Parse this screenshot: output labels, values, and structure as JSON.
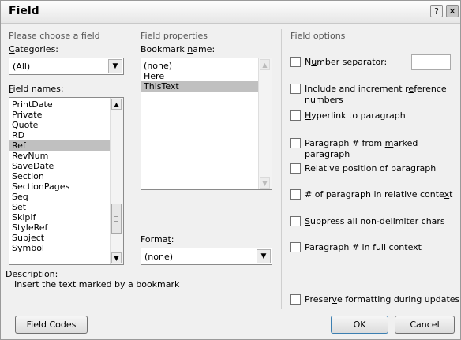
{
  "window": {
    "title": "Field",
    "help_button": "?",
    "close_button": "✕"
  },
  "left": {
    "header": "Please choose a field",
    "categories_label": "Categories:",
    "categories_value": "(All)",
    "field_names_label": "Field names:",
    "field_names": [
      "PrintDate",
      "Private",
      "Quote",
      "RD",
      "Ref",
      "RevNum",
      "SaveDate",
      "Section",
      "SectionPages",
      "Seq",
      "Set",
      "SkipIf",
      "StyleRef",
      "Subject",
      "Symbol"
    ],
    "selected_field": "Ref",
    "description_label": "Description:",
    "description_text": "Insert the text marked by a bookmark"
  },
  "middle": {
    "header": "Field properties",
    "bookmark_label": "Bookmark name:",
    "bookmarks": [
      "(none)",
      "Here",
      "ThisText"
    ],
    "selected_bookmark": "ThisText",
    "format_label": "Format:",
    "format_value": "(none)"
  },
  "right": {
    "header": "Field options",
    "options": [
      {
        "label": "Number separator:",
        "checked": false
      },
      {
        "label": "Include and increment reference numbers",
        "checked": false
      },
      {
        "label": "Hyperlink to paragraph",
        "checked": false
      },
      {
        "label": "Paragraph # from marked paragraph",
        "checked": false
      },
      {
        "label": "Relative position of paragraph",
        "checked": false
      },
      {
        "label": "# of paragraph in relative context",
        "checked": false
      },
      {
        "label": "Suppress all non-delimiter chars",
        "checked": false
      },
      {
        "label": "Paragraph # in full context",
        "checked": false
      },
      {
        "label": "Preserve formatting during updates",
        "checked": false
      }
    ]
  },
  "buttons": {
    "field_codes": "Field Codes",
    "ok": "OK",
    "cancel": "Cancel"
  }
}
